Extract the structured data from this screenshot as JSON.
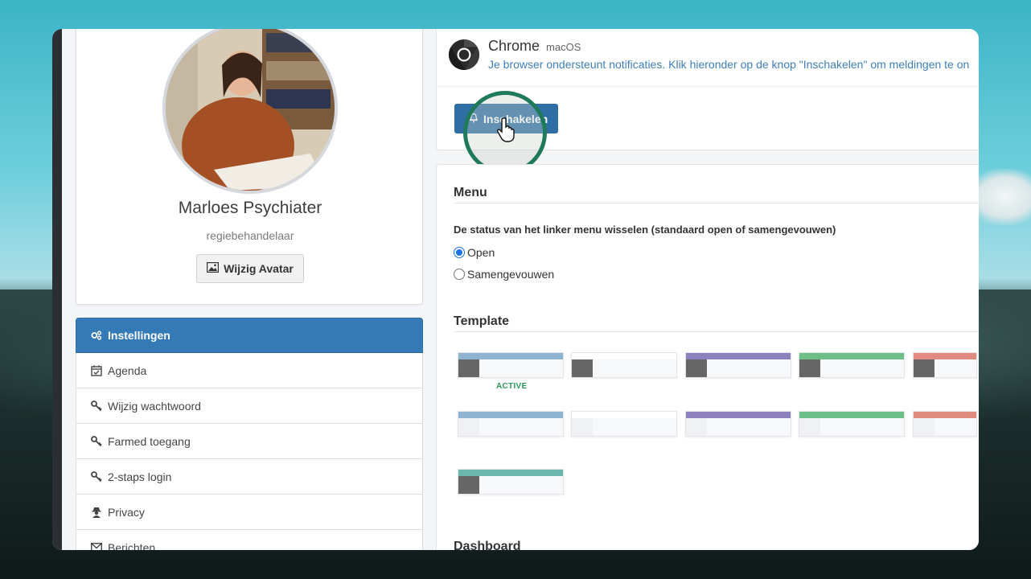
{
  "profile": {
    "name": "Marloes Psychiater",
    "role": "regiebehandelaar",
    "avatar_button": "Wijzig Avatar"
  },
  "menu": {
    "items": [
      {
        "label": "Instellingen",
        "icon": "gears-icon",
        "active": true
      },
      {
        "label": "Agenda",
        "icon": "calendar-check-icon",
        "active": false
      },
      {
        "label": "Wijzig wachtwoord",
        "icon": "key-icon",
        "active": false
      },
      {
        "label": "Farmed toegang",
        "icon": "key-icon",
        "active": false
      },
      {
        "label": "2-staps login",
        "icon": "key-icon",
        "active": false
      },
      {
        "label": "Privacy",
        "icon": "user-secret-icon",
        "active": false
      },
      {
        "label": "Berichten",
        "icon": "envelope-icon",
        "active": false
      }
    ]
  },
  "notification": {
    "browser": "Chrome",
    "os": "macOS",
    "message": "Je browser ondersteunt notificaties. Klik hieronder op de knop \"Inschakelen\" om meldingen te on",
    "button": "Inschakelen"
  },
  "settings": {
    "menu_title": "Menu",
    "menu_description": "De status van het linker menu wisselen (standaard open of samengevouwen)",
    "options": [
      {
        "label": "Open",
        "selected": true
      },
      {
        "label": "Samengevouwen",
        "selected": false
      }
    ],
    "template_title": "Template",
    "active_label": "ACTIVE",
    "dashboard_title": "Dashboard"
  },
  "colors": {
    "primary": "#337ab7",
    "ring": "#1f7a5c",
    "active_text": "#2e9a5a",
    "templates_row1": [
      "#8fb4d2",
      "#ffffff",
      "#8d82bd",
      "#6cbf86",
      "#e08a80"
    ],
    "templates_row2": [
      "#8fb4d2",
      "#ffffff",
      "#8d82bd",
      "#6cbf86",
      "#e08a80"
    ],
    "templates_row3": [
      "#6bb6ad"
    ]
  }
}
